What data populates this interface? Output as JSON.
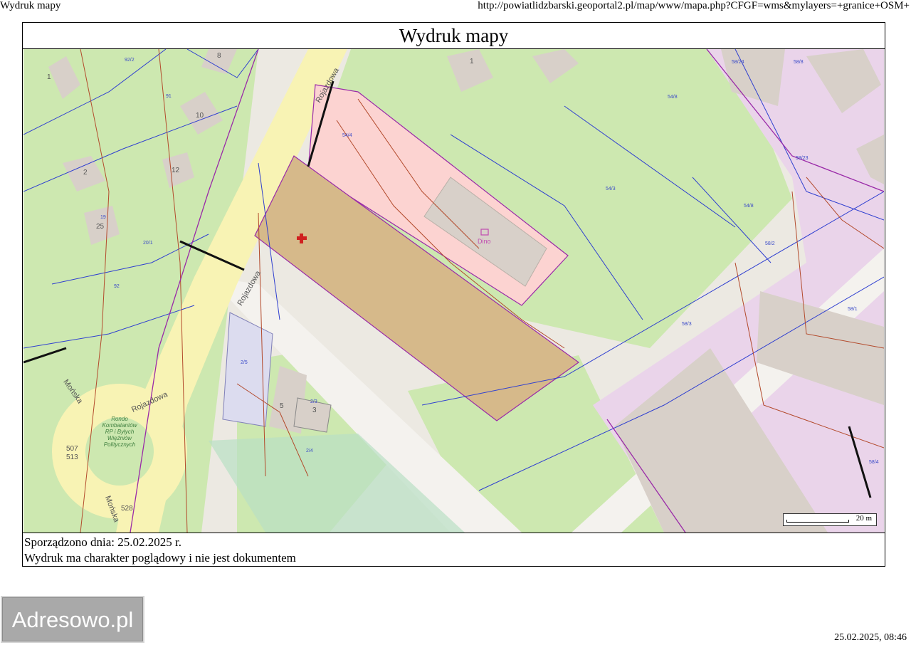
{
  "header": {
    "left": "Wydruk mapy",
    "right": "http://powiatlidzbarski.geoportal2.pl/map/www/mapa.php?CFGF=wms&mylayers=+granice+OSM+"
  },
  "title": "Wydruk mapy",
  "map": {
    "streets": [
      "Rojazdowa",
      "Rojazdowa",
      "Rojazdowa",
      "Mońska",
      "Mońska"
    ],
    "roundabout_label": [
      "Rondo",
      "Kombatantów",
      "RP i Byłych",
      "Więźniów",
      "Politycznych"
    ],
    "shop_label": "Dino",
    "building_numbers": [
      "1",
      "8",
      "10",
      "2",
      "12",
      "25",
      "5",
      "3",
      "1"
    ],
    "parcel_labels": [
      "54/4",
      "54/8",
      "54/3",
      "54/8",
      "58/24",
      "58/8",
      "58/23",
      "58/2",
      "58/1",
      "58/3",
      "58/4",
      "2/5",
      "2/3",
      "2/4",
      "92/2",
      "91",
      "19",
      "20/1",
      "92",
      "507",
      "513",
      "528"
    ],
    "colors": {
      "highlight_parcel": "#d6b98a",
      "pink_parcel": "#fcd3d1",
      "green_area": "#cde8b0",
      "road_yellow": "#f8f3b4",
      "violet_area": "#ead4ea",
      "building": "#d8d0c9",
      "cadastre_line": "#2f3fd0",
      "utility_line": "#b34a2c",
      "boundary": "#9a2aa8"
    },
    "marker_icon": "red-cross-icon"
  },
  "scale": {
    "label": "20 m"
  },
  "footer": {
    "line1": "Sporządzono dnia: 25.02.2025 r.",
    "line2": "Wydruk ma charakter poglądowy i nie jest dokumentem"
  },
  "logo": "Adresowo.pl",
  "timestamp": "25.02.2025, 08:46"
}
